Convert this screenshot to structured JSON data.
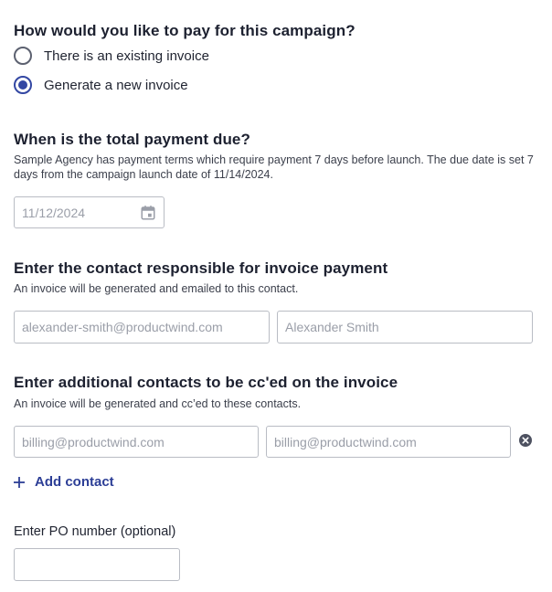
{
  "payment": {
    "question": "How would you like to pay for this campaign?",
    "options": [
      {
        "label": "There is an existing invoice",
        "selected": false
      },
      {
        "label": "Generate a new invoice",
        "selected": true
      }
    ]
  },
  "due": {
    "question": "When is the total payment due?",
    "description": "Sample Agency has payment terms which require payment 7 days before launch. The due date is set 7 days from the campaign launch date of 11/14/2024.",
    "date_placeholder": "11/12/2024"
  },
  "contact": {
    "question": "Enter the contact responsible for invoice payment",
    "description": "An invoice will be generated and emailed to this contact.",
    "email_placeholder": "alexander-smith@productwind.com",
    "name_placeholder": "Alexander Smith"
  },
  "cc": {
    "question": "Enter additional contacts to be cc'ed on the invoice",
    "description": "An invoice will be generated and cc’ed to these contacts.",
    "email_placeholder_1": "billing@productwind.com",
    "email_placeholder_2": "billing@productwind.com",
    "add_label": "Add contact"
  },
  "po": {
    "label": "Enter PO number (optional)",
    "value": ""
  },
  "icons": {
    "calendar": "calendar-icon",
    "remove": "close-circle-icon",
    "add": "plus-icon"
  },
  "colors": {
    "accent": "#3347a3",
    "link": "#2c3e96"
  }
}
